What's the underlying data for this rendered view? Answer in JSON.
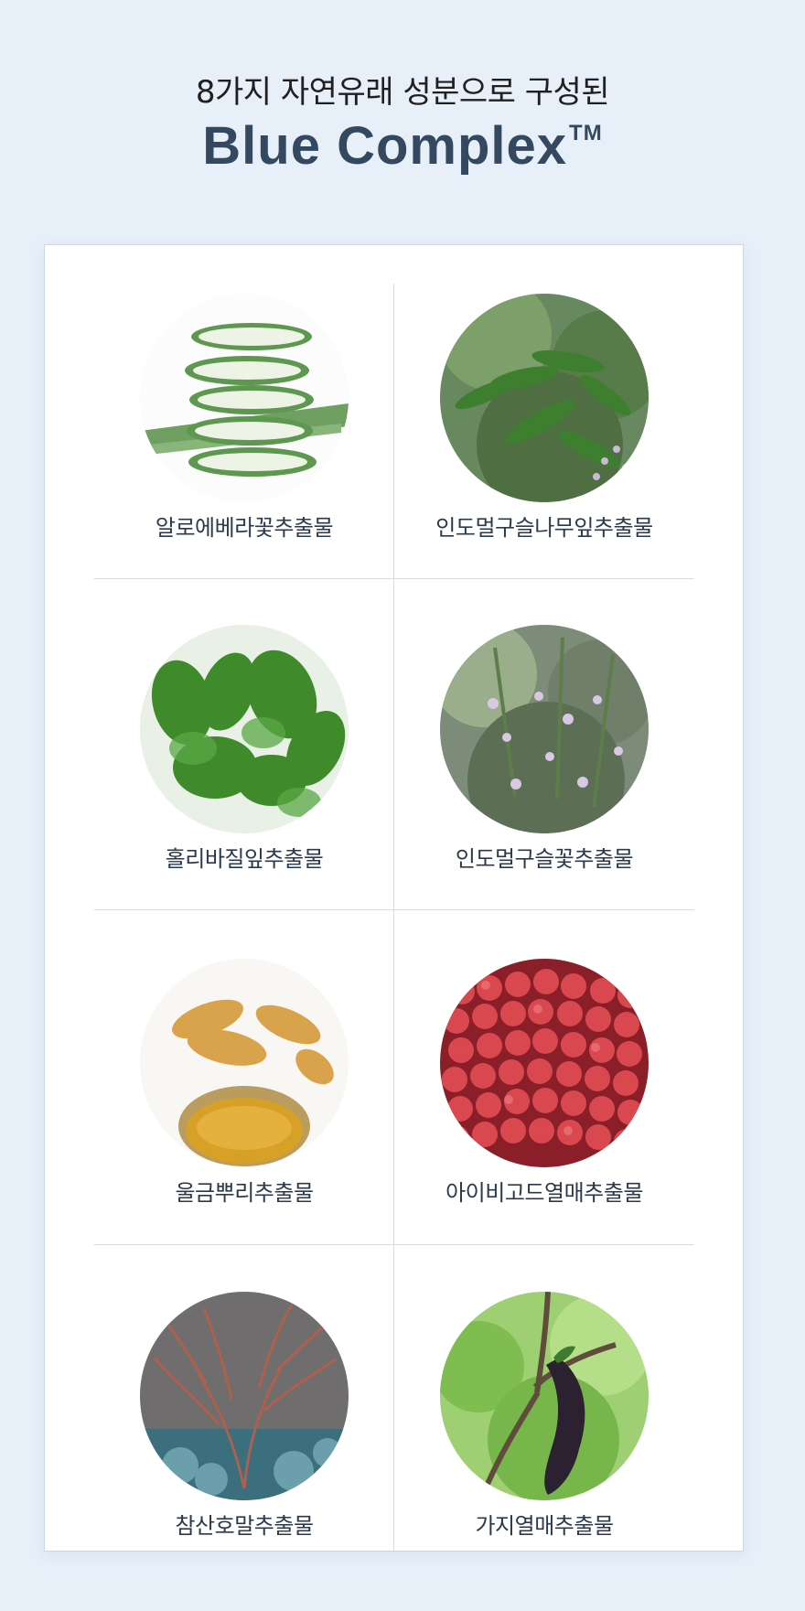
{
  "header": {
    "subtitle": "8가지 자연유래 성분으로 구성된",
    "title": "Blue Complex",
    "trademark": "TM"
  },
  "ingredients": [
    {
      "label": "알로에베라꽃추출물",
      "icon": "aloe-vera-image"
    },
    {
      "label": "인도멀구슬나무잎추출물",
      "icon": "neem-leaf-image"
    },
    {
      "label": "홀리바질잎추출물",
      "icon": "holy-basil-image"
    },
    {
      "label": "인도멀구슬꽃추출물",
      "icon": "neem-flower-image"
    },
    {
      "label": "울금뿌리추출물",
      "icon": "turmeric-root-image"
    },
    {
      "label": "아이비고드열매추출물",
      "icon": "ivy-gourd-fruit-image"
    },
    {
      "label": "참산호말추출물",
      "icon": "coral-seaweed-image"
    },
    {
      "label": "가지열매추출물",
      "icon": "eggplant-fruit-image"
    }
  ],
  "colors": {
    "background": "#e7eff9",
    "title": "#34495f",
    "text": "#202020",
    "card": "#ffffff",
    "divider": "#dcdcdc"
  }
}
